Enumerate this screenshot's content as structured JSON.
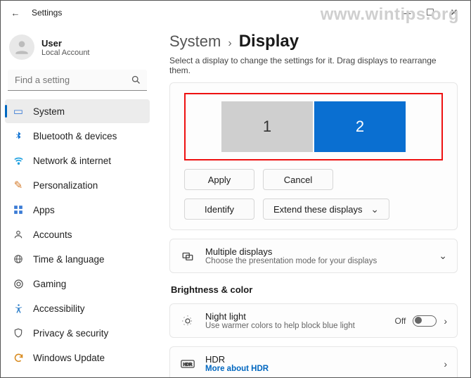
{
  "window": {
    "title": "Settings"
  },
  "watermark": "www.wintips.org",
  "user": {
    "name": "User",
    "type": "Local Account"
  },
  "search": {
    "placeholder": "Find a setting"
  },
  "nav": [
    {
      "label": "System"
    },
    {
      "label": "Bluetooth & devices"
    },
    {
      "label": "Network & internet"
    },
    {
      "label": "Personalization"
    },
    {
      "label": "Apps"
    },
    {
      "label": "Accounts"
    },
    {
      "label": "Time & language"
    },
    {
      "label": "Gaming"
    },
    {
      "label": "Accessibility"
    },
    {
      "label": "Privacy & security"
    },
    {
      "label": "Windows Update"
    }
  ],
  "breadcrumb": {
    "parent": "System",
    "current": "Display"
  },
  "subtext": "Select a display to change the settings for it. Drag displays to rearrange them.",
  "monitors": {
    "m1": "1",
    "m2": "2"
  },
  "buttons": {
    "apply": "Apply",
    "cancel": "Cancel",
    "identify": "Identify",
    "extend": "Extend these displays"
  },
  "cards": {
    "multi": {
      "title": "Multiple displays",
      "sub": "Choose the presentation mode for your displays"
    },
    "night": {
      "title": "Night light",
      "sub": "Use warmer colors to help block blue light",
      "state": "Off"
    },
    "hdr": {
      "title": "HDR",
      "link": "More about HDR"
    }
  },
  "sections": {
    "brightness": "Brightness & color"
  }
}
